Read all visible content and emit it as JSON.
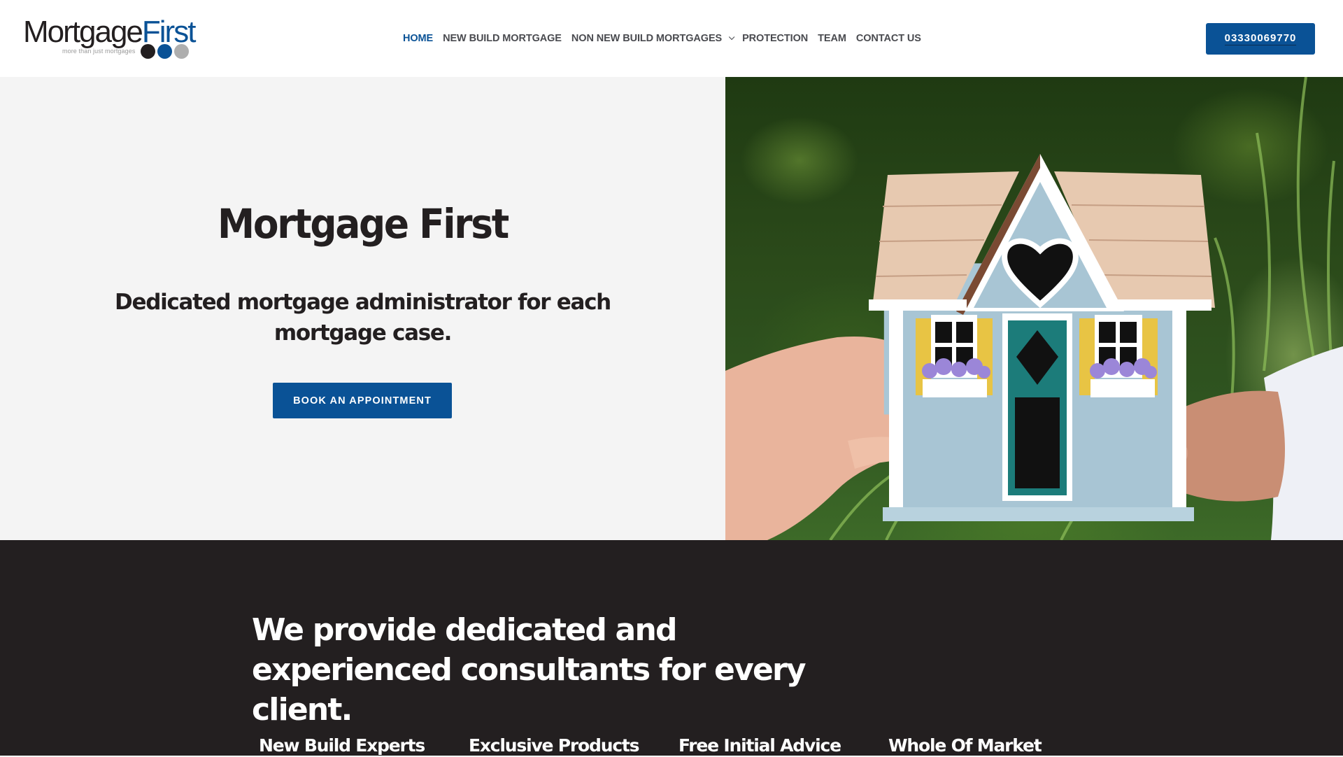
{
  "header": {
    "logo": {
      "word_part1": "Mortgage",
      "word_part2": "First",
      "tagline": "more than just mortgages",
      "dot_colors": [
        "#231f20",
        "#0a5296",
        "#aeaeae"
      ]
    },
    "nav": {
      "items": [
        {
          "label": "HOME",
          "active": true
        },
        {
          "label": "NEW BUILD MORTGAGE",
          "active": false
        },
        {
          "label": "NON NEW BUILD MORTGAGES",
          "active": false,
          "has_dropdown": true,
          "icon": "chevron-down-icon"
        },
        {
          "label": "PROTECTION",
          "active": false
        },
        {
          "label": "TEAM",
          "active": false
        },
        {
          "label": "CONTACT US",
          "active": false
        }
      ]
    },
    "phone_button": "03330069770"
  },
  "hero": {
    "title": "Mortgage First",
    "subtitle": "Dedicated mortgage administrator for each mortgage case.",
    "cta_label": "BOOK AN APPOINTMENT",
    "image_description": "Two hands holding a small blue wooden model house with a heart-shaped window, yellow shutters, a teal door and purple flower boxes, against green foliage"
  },
  "features": {
    "heading": "We provide dedicated and experienced consultants for every client.",
    "items": [
      {
        "label": "New Build Experts"
      },
      {
        "label": "Exclusive Products"
      },
      {
        "label": "Free Initial Advice"
      },
      {
        "label": "Whole Of Market"
      }
    ]
  },
  "colors": {
    "brand_blue": "#0a5296",
    "dark": "#231f20",
    "hero_bg": "#f4f4f4",
    "nav_text": "#4a4b50"
  }
}
